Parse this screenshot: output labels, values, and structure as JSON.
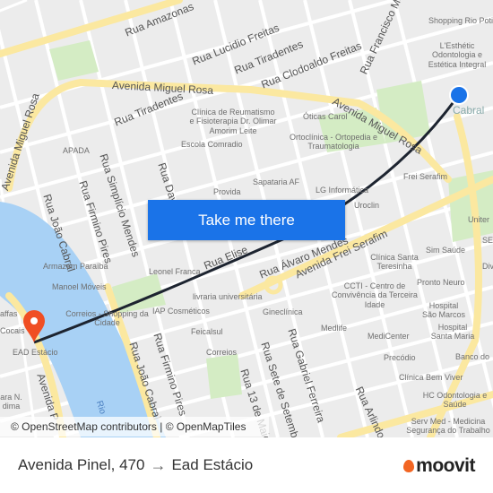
{
  "map": {
    "cta_label": "Take me there",
    "attribution": "© OpenStreetMap contributors | © OpenMapTiles",
    "colors": {
      "water": "#a8d1f5",
      "park": "#d4ecc4",
      "major_road": "#fbe8a0",
      "route": "#1d2430",
      "origin": "#1a73e8",
      "destination": "#f04e23"
    },
    "origin_label": "Cabral",
    "destination_label": "EAD Estácio",
    "streets": [
      "Avenida Miguel Rosa",
      "Avenida Miguel Rosa",
      "Avenida Miguel Rosa",
      "Rua Amazonas",
      "Rua Lucidio Freitas",
      "Rua Tiradentes",
      "Rua Tiradentes",
      "Rua Clodoaldo Freitas",
      "Rua Francisco Me",
      "Rua João Cabral",
      "Rua Firmino Pires",
      "Rua Simplício Mendes",
      "Rua Davi",
      "Rua Elise",
      "Rua Álvaro Mendes",
      "Avenida Frei Serafim",
      "Rua João Cabral",
      "Rua Firmino Pires",
      "Rua 13 de Maio",
      "Rua Sete de Setembro",
      "Rua Gabriel Ferreira",
      "Rua Arlindo",
      "Avenida P",
      "Rio"
    ],
    "pois": [
      "Shopping Rio Poti",
      "L'Esthétic Odontologia e Estética Integral",
      "Clínica de Reumatismo e Fisioterapia Dr. Olimar Amorim Leite",
      "Óticas Carol",
      "Ortoclínica - Ortopedia e Traumatologia",
      "Escola Comradio",
      "APADA",
      "Provida",
      "Sapataria AF",
      "LG Informática",
      "Uroclin",
      "Frei Serafim",
      "Sim Saúde",
      "Clínica Santa Teresinha",
      "CCTI - Centro de Convivência da Terceira Idade",
      "Pronto Neuro",
      "Hospital São Marcos",
      "Hospital Santa Maria",
      "Armazém Paraíba",
      "Manoel Móveis",
      "Leonel Franca",
      "livraria universitária",
      "IAP Cosméticos",
      "Correios - Shopping da Cidade",
      "Feicalsul",
      "Gineclínica",
      "Medlife",
      "MediCenter",
      "Correios",
      "Precódio",
      "Clínica Bem Viver",
      "Banco do",
      "HC Odontologia e Saúde",
      "Serv Med - Medicina Segurança do Trabalho",
      "Cocais",
      "affas",
      "ara N. dima",
      "Uniter",
      "Div",
      "SES"
    ]
  },
  "footer": {
    "origin": "Avenida Pinel, 470",
    "arrow": "→",
    "destination": "Ead Estácio",
    "brand": "moovit"
  }
}
